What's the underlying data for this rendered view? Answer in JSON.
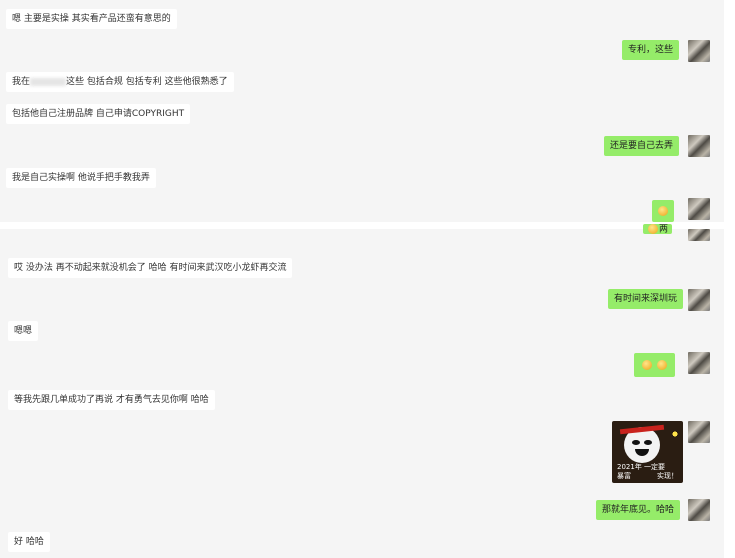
{
  "messages": [
    {
      "side": "in",
      "text": "嗯 主要是实操 其实看产品还蛮有意思的"
    },
    {
      "side": "out",
      "text": "专利，这些"
    },
    {
      "side": "in",
      "text_before": "我在",
      "text_after": "这些 包括合规 包括专利 这些他很熟悉了"
    },
    {
      "side": "in",
      "text": "包括他自己注册品牌 自己申请COPYRIGHT"
    },
    {
      "side": "out",
      "text": "还是要自己去弄"
    },
    {
      "side": "in",
      "text": "我是自己实操啊 他说手把手教我弄"
    },
    {
      "side": "out",
      "emoji": "smile-emoji"
    },
    {
      "side": "out",
      "partial": true,
      "text": "两"
    },
    {
      "side": "in",
      "text": "哎 没办法 再不动起来就没机会了 哈哈 有时间来武汉吃小龙虾再交流"
    },
    {
      "side": "out",
      "text": "有时间来深圳玩"
    },
    {
      "side": "in",
      "text": "嗯嗯"
    },
    {
      "side": "out",
      "emoji": "smile-emoji-pair"
    },
    {
      "side": "in",
      "text": "等我先跟几单成功了再说 才有勇气去见你啊 哈哈"
    },
    {
      "side": "out",
      "sticker": {
        "caption_line1": "2021年 一定要",
        "caption_line2": "暴富",
        "caption_line2b": "实现！"
      }
    },
    {
      "side": "out",
      "text": "那就年底见。哈哈"
    },
    {
      "side": "in",
      "text": "好 哈哈"
    }
  ],
  "colors": {
    "chat_background": "#f5f5f5",
    "incoming_bubble": "#ffffff",
    "outgoing_bubble": "#95ec69"
  }
}
